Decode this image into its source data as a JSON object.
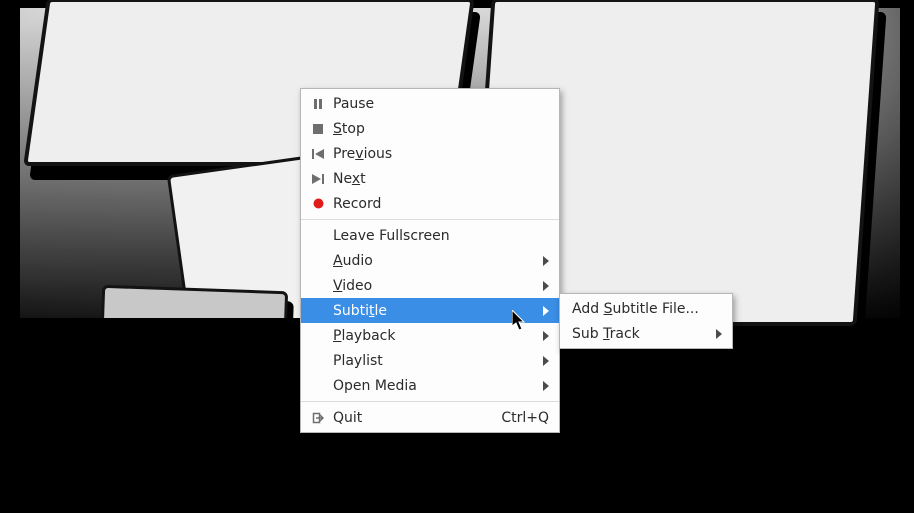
{
  "menu": {
    "pause": {
      "label": "Pause",
      "u": -1,
      "icon": "pause",
      "submenu": false
    },
    "stop": {
      "label": "Stop",
      "u": 0,
      "icon": "stop",
      "submenu": false
    },
    "previous": {
      "label": "Previous",
      "u": 3,
      "icon": "prev",
      "submenu": false
    },
    "next": {
      "label": "Next",
      "u": 2,
      "icon": "next",
      "submenu": false
    },
    "record": {
      "label": "Record",
      "u": -1,
      "icon": "record",
      "submenu": false
    },
    "leave_fs": {
      "label": "Leave Fullscreen",
      "u": -1,
      "icon": "",
      "submenu": false
    },
    "audio": {
      "label": "Audio",
      "u": 0,
      "icon": "",
      "submenu": true
    },
    "video": {
      "label": "Video",
      "u": 0,
      "icon": "",
      "submenu": true
    },
    "subtitle": {
      "label": "Subtitle",
      "u": 5,
      "icon": "",
      "submenu": true
    },
    "playback": {
      "label": "Playback",
      "u": 0,
      "icon": "",
      "submenu": true
    },
    "playlist": {
      "label": "Playlist",
      "u": -1,
      "icon": "",
      "submenu": true
    },
    "open_media": {
      "label": "Open Media",
      "u": -1,
      "icon": "",
      "submenu": true
    },
    "quit": {
      "label": "Quit",
      "u": -1,
      "icon": "quit",
      "submenu": false,
      "shortcut": "Ctrl+Q"
    }
  },
  "submenu_subtitle": {
    "add_file": {
      "label": "Add Subtitle File...",
      "u": 4,
      "submenu": false
    },
    "sub_track": {
      "label": "Sub Track",
      "u": 4,
      "submenu": true
    }
  }
}
